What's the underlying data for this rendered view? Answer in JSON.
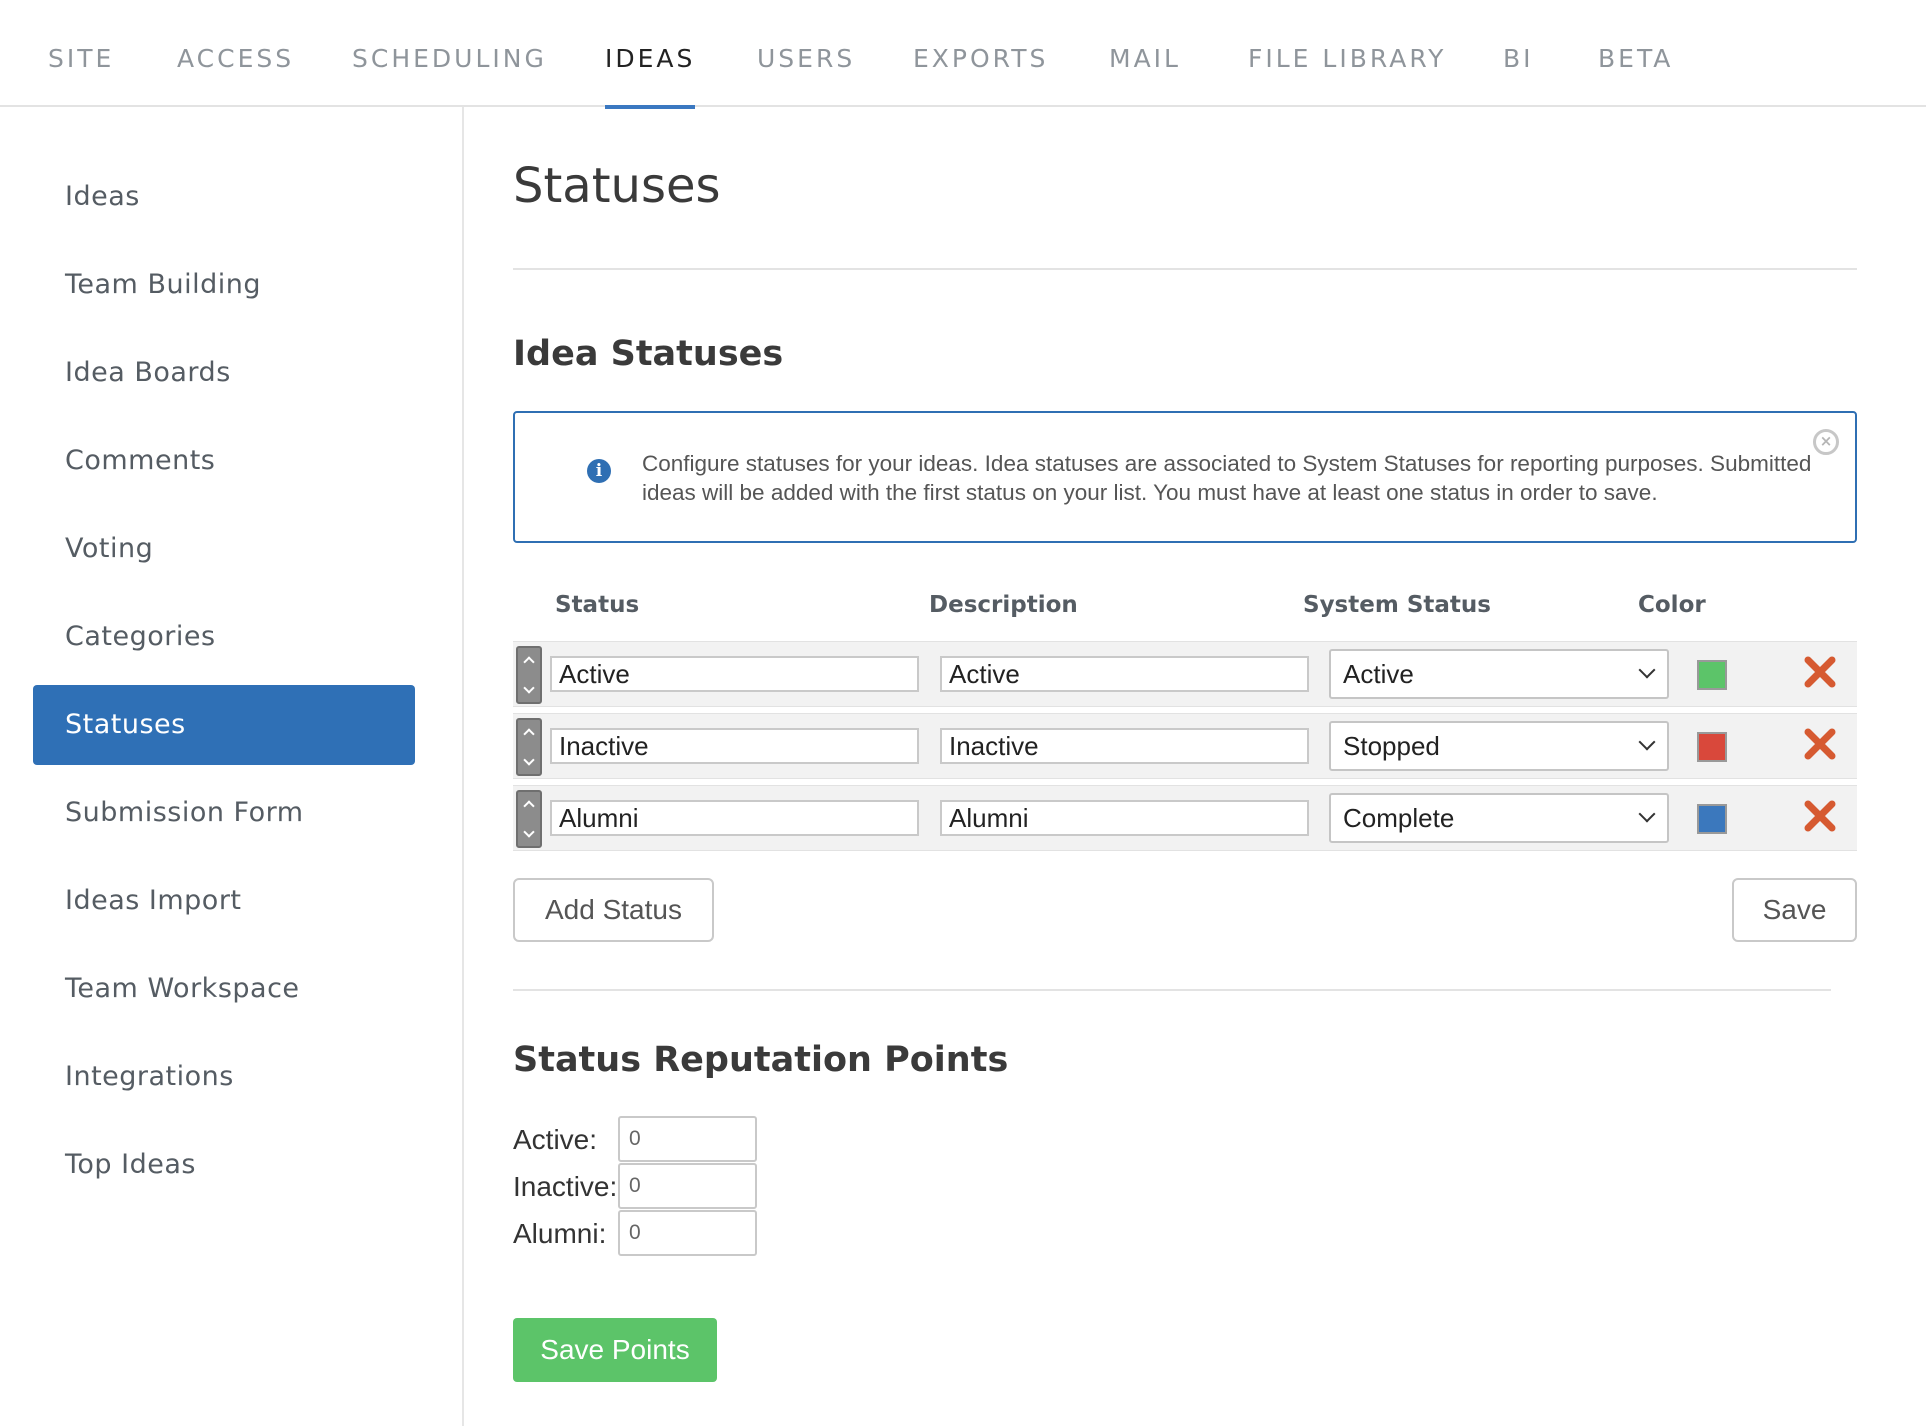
{
  "topnav": {
    "tabs": [
      {
        "label": "SITE"
      },
      {
        "label": "ACCESS"
      },
      {
        "label": "SCHEDULING"
      },
      {
        "label": "IDEAS"
      },
      {
        "label": "USERS"
      },
      {
        "label": "EXPORTS"
      },
      {
        "label": "MAIL"
      },
      {
        "label": "FILE LIBRARY"
      },
      {
        "label": "BI"
      },
      {
        "label": "BETA"
      }
    ],
    "active": "IDEAS"
  },
  "sidebar": {
    "items": [
      {
        "label": "Ideas"
      },
      {
        "label": "Team Building"
      },
      {
        "label": "Idea Boards"
      },
      {
        "label": "Comments"
      },
      {
        "label": "Voting"
      },
      {
        "label": "Categories"
      },
      {
        "label": "Statuses"
      },
      {
        "label": "Submission Form"
      },
      {
        "label": "Ideas Import"
      },
      {
        "label": "Team Workspace"
      },
      {
        "label": "Integrations"
      },
      {
        "label": "Top Ideas"
      }
    ],
    "active": "Statuses"
  },
  "main": {
    "title": "Statuses",
    "idea_statuses": {
      "heading": "Idea Statuses",
      "info_text": "Configure statuses for your ideas. Idea statuses are associated to System Statuses for reporting purposes. Submitted ideas will be added with the first status on your list. You must have at least one status in order to save.",
      "columns": {
        "status": "Status",
        "description": "Description",
        "system_status": "System Status",
        "color": "Color"
      },
      "rows": [
        {
          "status": "Active",
          "description": "Active",
          "system_status": "Active",
          "color": "#5cc469"
        },
        {
          "status": "Inactive",
          "description": "Inactive",
          "system_status": "Stopped",
          "color": "#d9483b"
        },
        {
          "status": "Alumni",
          "description": "Alumni",
          "system_status": "Complete",
          "color": "#3b78bd"
        }
      ],
      "add_button": "Add Status",
      "save_button": "Save"
    },
    "reputation": {
      "heading": "Status Reputation Points",
      "items": [
        {
          "label": "Active:",
          "value": "0"
        },
        {
          "label": "Inactive:",
          "value": "0"
        },
        {
          "label": "Alumni:",
          "value": "0"
        }
      ],
      "save_button": "Save Points"
    }
  },
  "colors": {
    "accent": "#2f70b6",
    "success": "#5cc469",
    "delete": "#d65a31"
  }
}
